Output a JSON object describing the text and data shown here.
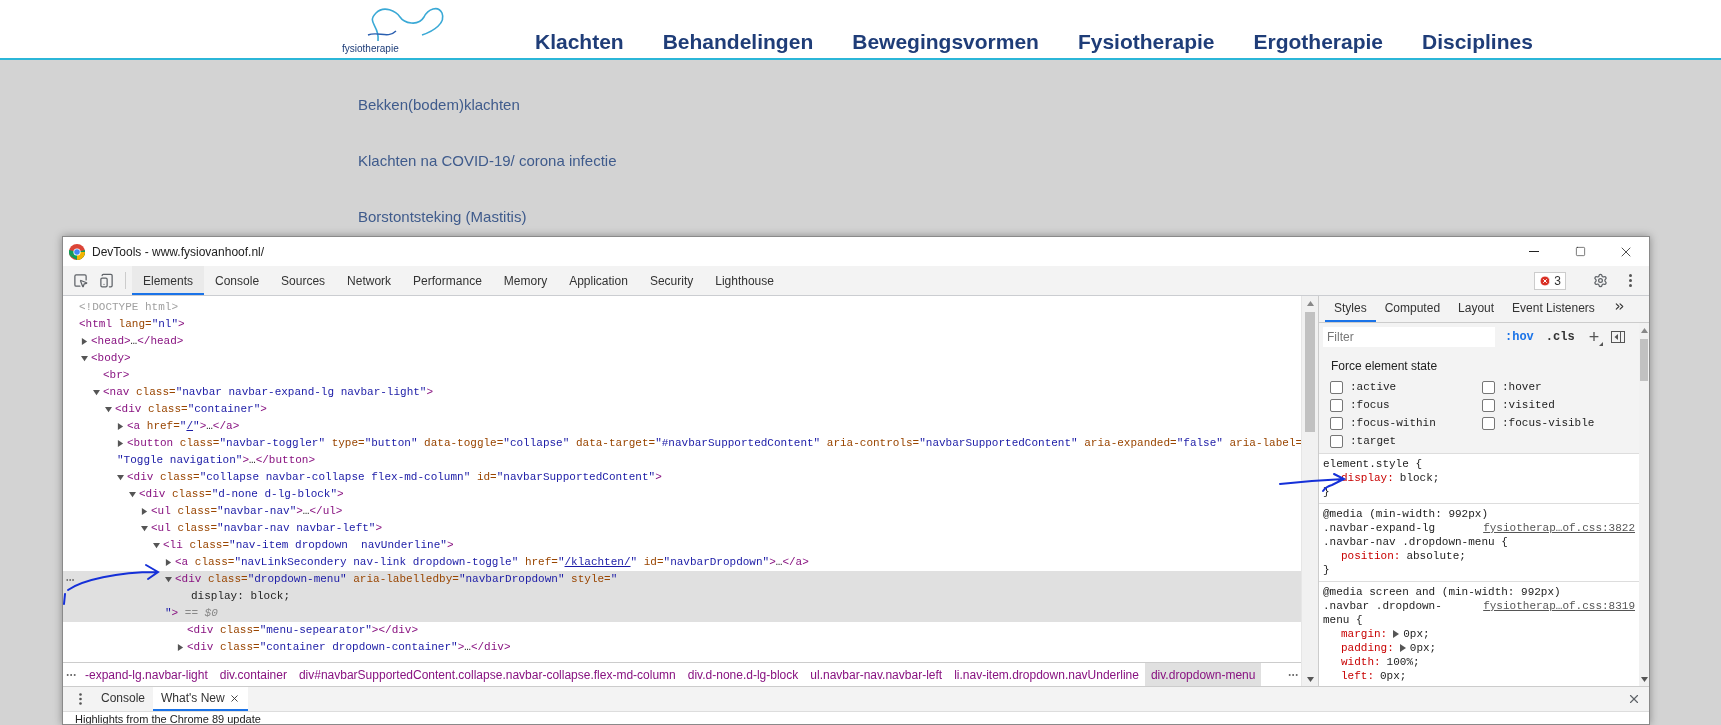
{
  "website": {
    "logo_text": "fysiotherapie",
    "nav": [
      "Klachten",
      "Behandelingen",
      "Bewegingsvormen",
      "Fysiotherapie",
      "Ergotherapie",
      "Disciplines"
    ],
    "dropdown_items": [
      "Bekken(bodem)klachten",
      "Klachten na COVID-19/ corona infectie",
      "Borstontsteking (Mastitis)"
    ]
  },
  "devtools": {
    "title": "DevTools - www.fysiovanhoof.nl/",
    "tabs": [
      {
        "label": "Elements",
        "selected": true
      },
      {
        "label": "Console",
        "selected": false
      },
      {
        "label": "Sources",
        "selected": false
      },
      {
        "label": "Network",
        "selected": false
      },
      {
        "label": "Performance",
        "selected": false
      },
      {
        "label": "Memory",
        "selected": false
      },
      {
        "label": "Application",
        "selected": false
      },
      {
        "label": "Security",
        "selected": false
      },
      {
        "label": "Lighthouse",
        "selected": false
      }
    ],
    "error_count": "3",
    "dom_tree": [
      {
        "selected": false,
        "lines": [
          {
            "kind": "start",
            "tokens": [
              {
                "kind": "comment",
                "text": "<!DOCTYPE html>"
              }
            ]
          }
        ]
      },
      {
        "selected": false,
        "lines": [
          {
            "kind": "start",
            "tokens": [
              {
                "kind": "tag",
                "text": "<html"
              },
              {
                "kind": "attr",
                "text": " lang="
              },
              {
                "kind": "value",
                "text": "\"nl\""
              },
              {
                "kind": "tag",
                "text": ">"
              }
            ]
          }
        ],
        "children": [
          {
            "selected": false,
            "expanded": false,
            "lines": [
              {
                "kind": "start",
                "tokens": [
                  {
                    "kind": "tag",
                    "text": "<head>"
                  },
                  {
                    "kind": "text",
                    "text": "…"
                  },
                  {
                    "kind": "tag",
                    "text": "</head>"
                  }
                ]
              }
            ]
          },
          {
            "selected": false,
            "expanded": true,
            "lines": [
              {
                "kind": "start",
                "tokens": [
                  {
                    "kind": "tag",
                    "text": "<body>"
                  }
                ]
              }
            ],
            "children": [
              {
                "selected": false,
                "lines": [
                  {
                    "kind": "start",
                    "tokens": [
                      {
                        "kind": "tag",
                        "text": "<br>"
                      }
                    ]
                  }
                ]
              },
              {
                "selected": false,
                "expanded": true,
                "lines": [
                  {
                    "kind": "start",
                    "tokens": [
                      {
                        "kind": "tag",
                        "text": "<nav"
                      },
                      {
                        "kind": "attr",
                        "text": " class="
                      },
                      {
                        "kind": "value",
                        "text": "\"navbar navbar-expand-lg navbar-light\""
                      },
                      {
                        "kind": "tag",
                        "text": ">"
                      }
                    ]
                  }
                ],
                "children": [
                  {
                    "selected": false,
                    "expanded": true,
                    "lines": [
                      {
                        "kind": "start",
                        "tokens": [
                          {
                            "kind": "tag",
                            "text": "<div"
                          },
                          {
                            "kind": "attr",
                            "text": " class="
                          },
                          {
                            "kind": "value",
                            "text": "\"container\""
                          },
                          {
                            "kind": "tag",
                            "text": ">"
                          }
                        ]
                      }
                    ],
                    "children": [
                      {
                        "selected": false,
                        "expanded": false,
                        "lines": [
                          {
                            "kind": "start",
                            "tokens": [
                              {
                                "kind": "tag",
                                "text": "<a"
                              },
                              {
                                "kind": "attr",
                                "text": " href="
                              },
                              {
                                "kind": "value",
                                "text": "\""
                              },
                              {
                                "kind": "link",
                                "text": "/"
                              },
                              {
                                "kind": "value",
                                "text": "\""
                              },
                              {
                                "kind": "tag",
                                "text": ">"
                              },
                              {
                                "kind": "text",
                                "text": "…"
                              },
                              {
                                "kind": "tag",
                                "text": "</a>"
                              }
                            ]
                          }
                        ]
                      },
                      {
                        "selected": false,
                        "expanded": false,
                        "lines": [
                          {
                            "kind": "start",
                            "tokens": [
                              {
                                "kind": "tag",
                                "text": "<button"
                              },
                              {
                                "kind": "attr",
                                "text": " class="
                              },
                              {
                                "kind": "value",
                                "text": "\"navbar-toggler\""
                              },
                              {
                                "kind": "attr",
                                "text": " type="
                              },
                              {
                                "kind": "value",
                                "text": "\"button\""
                              },
                              {
                                "kind": "attr",
                                "text": " data-toggle="
                              },
                              {
                                "kind": "value",
                                "text": "\"collapse\""
                              },
                              {
                                "kind": "attr",
                                "text": " data-target="
                              },
                              {
                                "kind": "value",
                                "text": "\"#navbarSupportedContent\""
                              },
                              {
                                "kind": "attr",
                                "text": " aria-controls="
                              },
                              {
                                "kind": "value",
                                "text": "\"navbarSupportedContent\""
                              },
                              {
                                "kind": "attr",
                                "text": " aria-expanded="
                              },
                              {
                                "kind": "value",
                                "text": "\"false\""
                              },
                              {
                                "kind": "attr",
                                "text": " aria-label="
                              }
                            ]
                          },
                          {
                            "kind": "wrap",
                            "tokens": [
                              {
                                "kind": "value",
                                "text": "\"Toggle navigation\""
                              },
                              {
                                "kind": "tag",
                                "text": ">"
                              },
                              {
                                "kind": "text",
                                "text": "…"
                              },
                              {
                                "kind": "tag",
                                "text": "</button>"
                              }
                            ]
                          }
                        ]
                      },
                      {
                        "selected": false,
                        "expanded": true,
                        "lines": [
                          {
                            "kind": "start",
                            "tokens": [
                              {
                                "kind": "tag",
                                "text": "<div"
                              },
                              {
                                "kind": "attr",
                                "text": " class="
                              },
                              {
                                "kind": "value",
                                "text": "\"collapse navbar-collapse flex-md-column\""
                              },
                              {
                                "kind": "attr",
                                "text": " id="
                              },
                              {
                                "kind": "value",
                                "text": "\"navbarSupportedContent\""
                              },
                              {
                                "kind": "tag",
                                "text": ">"
                              }
                            ]
                          }
                        ],
                        "children": [
                          {
                            "selected": false,
                            "expanded": true,
                            "lines": [
                              {
                                "kind": "start",
                                "tokens": [
                                  {
                                    "kind": "tag",
                                    "text": "<div"
                                  },
                                  {
                                    "kind": "attr",
                                    "text": " class="
                                  },
                                  {
                                    "kind": "value",
                                    "text": "\"d-none d-lg-block\""
                                  },
                                  {
                                    "kind": "tag",
                                    "text": ">"
                                  }
                                ]
                              }
                            ],
                            "children": [
                              {
                                "selected": false,
                                "expanded": false,
                                "lines": [
                                  {
                                    "kind": "start",
                                    "tokens": [
                                      {
                                        "kind": "tag",
                                        "text": "<ul"
                                      },
                                      {
                                        "kind": "attr",
                                        "text": " class="
                                      },
                                      {
                                        "kind": "value",
                                        "text": "\"navbar-nav\""
                                      },
                                      {
                                        "kind": "tag",
                                        "text": ">"
                                      },
                                      {
                                        "kind": "text",
                                        "text": "…"
                                      },
                                      {
                                        "kind": "tag",
                                        "text": "</ul>"
                                      }
                                    ]
                                  }
                                ]
                              },
                              {
                                "selected": false,
                                "expanded": true,
                                "lines": [
                                  {
                                    "kind": "start",
                                    "tokens": [
                                      {
                                        "kind": "tag",
                                        "text": "<ul"
                                      },
                                      {
                                        "kind": "attr",
                                        "text": " class="
                                      },
                                      {
                                        "kind": "value",
                                        "text": "\"navbar-nav navbar-left\""
                                      },
                                      {
                                        "kind": "tag",
                                        "text": ">"
                                      }
                                    ]
                                  }
                                ],
                                "children": [
                                  {
                                    "selected": false,
                                    "expanded": true,
                                    "lines": [
                                      {
                                        "kind": "start",
                                        "tokens": [
                                          {
                                            "kind": "tag",
                                            "text": "<li"
                                          },
                                          {
                                            "kind": "attr",
                                            "text": " class="
                                          },
                                          {
                                            "kind": "value",
                                            "text": "\"nav-item dropdown  navUnderline\""
                                          },
                                          {
                                            "kind": "tag",
                                            "text": ">"
                                          }
                                        ]
                                      }
                                    ],
                                    "children": [
                                      {
                                        "selected": false,
                                        "expanded": false,
                                        "lines": [
                                          {
                                            "kind": "start",
                                            "tokens": [
                                              {
                                                "kind": "tag",
                                                "text": "<a"
                                              },
                                              {
                                                "kind": "attr",
                                                "text": " class="
                                              },
                                              {
                                                "kind": "value",
                                                "text": "\"navLinkSecondery nav-link dropdown-toggle\""
                                              },
                                              {
                                                "kind": "attr",
                                                "text": " href="
                                              },
                                              {
                                                "kind": "value",
                                                "text": "\""
                                              },
                                              {
                                                "kind": "link",
                                                "text": "/klachten/"
                                              },
                                              {
                                                "kind": "value",
                                                "text": "\""
                                              },
                                              {
                                                "kind": "attr",
                                                "text": " id="
                                              },
                                              {
                                                "kind": "value",
                                                "text": "\"navbarDropdown\""
                                              },
                                              {
                                                "kind": "tag",
                                                "text": ">"
                                              },
                                              {
                                                "kind": "text",
                                                "text": "…"
                                              },
                                              {
                                                "kind": "tag",
                                                "text": "</a>"
                                              }
                                            ]
                                          }
                                        ]
                                      },
                                      {
                                        "selected": true,
                                        "expanded": true,
                                        "lines": [
                                          {
                                            "kind": "start",
                                            "tokens": [
                                              {
                                                "kind": "tag",
                                                "text": "<div"
                                              },
                                              {
                                                "kind": "attr",
                                                "text": " class="
                                              },
                                              {
                                                "kind": "value",
                                                "text": "\"dropdown-menu\""
                                              },
                                              {
                                                "kind": "attr",
                                                "text": " aria-labelledby="
                                              },
                                              {
                                                "kind": "value",
                                                "text": "\"navbarDropdown\""
                                              },
                                              {
                                                "kind": "attr",
                                                "text": " style="
                                              },
                                              {
                                                "kind": "value",
                                                "text": "\""
                                              }
                                            ]
                                          },
                                          {
                                            "kind": "inner",
                                            "tokens": [
                                              {
                                                "kind": "text",
                                                "text": "display: block;"
                                              }
                                            ]
                                          },
                                          {
                                            "kind": "wrap",
                                            "tokens": [
                                              {
                                                "kind": "value",
                                                "text": "\""
                                              },
                                              {
                                                "kind": "tag",
                                                "text": ">"
                                              },
                                              {
                                                "kind": "marker",
                                                "text": " == $0"
                                              }
                                            ]
                                          }
                                        ],
                                        "children": [
                                          {
                                            "selected": false,
                                            "lines": [
                                              {
                                                "kind": "start",
                                                "tokens": [
                                                  {
                                                    "kind": "tag",
                                                    "text": "<div"
                                                  },
                                                  {
                                                    "kind": "attr",
                                                    "text": " class="
                                                  },
                                                  {
                                                    "kind": "value",
                                                    "text": "\"menu-sepearator\""
                                                  },
                                                  {
                                                    "kind": "tag",
                                                    "text": "></div>"
                                                  }
                                                ]
                                              }
                                            ]
                                          },
                                          {
                                            "selected": false,
                                            "expanded": false,
                                            "lines": [
                                              {
                                                "kind": "start",
                                                "tokens": [
                                                  {
                                                    "kind": "tag",
                                                    "text": "<div"
                                                  },
                                                  {
                                                    "kind": "attr",
                                                    "text": " class="
                                                  },
                                                  {
                                                    "kind": "value",
                                                    "text": "\"container dropdown-container\""
                                                  },
                                                  {
                                                    "kind": "tag",
                                                    "text": ">"
                                                  },
                                                  {
                                                    "kind": "text",
                                                    "text": "…"
                                                  },
                                                  {
                                                    "kind": "tag",
                                                    "text": "</div>"
                                                  }
                                                ]
                                              }
                                            ]
                                          }
                                        ]
                                      }
                                    ]
                                  }
                                ]
                              }
                            ]
                          }
                        ]
                      }
                    ]
                  }
                ]
              }
            ]
          }
        ]
      }
    ],
    "breadcrumbs": [
      {
        "label": "-expand-lg.navbar-light",
        "selected": false
      },
      {
        "label": "div.container",
        "selected": false
      },
      {
        "label": "div#navbarSupportedContent.collapse.navbar-collapse.flex-md-column",
        "selected": false
      },
      {
        "label": "div.d-none.d-lg-block",
        "selected": false
      },
      {
        "label": "ul.navbar-nav.navbar-left",
        "selected": false
      },
      {
        "label": "li.nav-item.dropdown.navUnderline",
        "selected": false
      },
      {
        "label": "div.dropdown-menu",
        "selected": true
      }
    ],
    "styles_tabs": [
      {
        "label": "Styles",
        "selected": true
      },
      {
        "label": "Computed",
        "selected": false
      },
      {
        "label": "Layout",
        "selected": false
      },
      {
        "label": "Event Listeners",
        "selected": false
      }
    ],
    "filter": {
      "placeholder": "Filter"
    },
    "hov": {
      "label": ":hov",
      "on": true
    },
    "cls": ".cls",
    "add": "+",
    "force_title": "Force element state",
    "force_states": [
      {
        "label": ":active",
        "checked": false
      },
      {
        "label": ":hover",
        "checked": false
      },
      {
        "label": ":focus",
        "checked": false
      },
      {
        "label": ":visited",
        "checked": false
      },
      {
        "label": ":focus-within",
        "checked": false
      },
      {
        "label": ":focus-visible",
        "checked": false
      },
      {
        "label": ":target",
        "checked": false
      }
    ],
    "rules": [
      {
        "lines": [
          {
            "text": "element.style {"
          }
        ],
        "declarations": [
          {
            "property": "display:",
            "value": "block;",
            "expandable": false
          }
        ],
        "close": "}"
      },
      {
        "lines": [
          {
            "text": "@media (min-width: 992px)"
          },
          {
            "text": ".navbar-expand-lg",
            "source": "fysiotherap…of.css:3822"
          },
          {
            "text": ".navbar-nav .dropdown-menu {"
          }
        ],
        "declarations": [
          {
            "property": "position:",
            "value": "absolute;",
            "expandable": false
          }
        ],
        "close": "}"
      },
      {
        "lines": [
          {
            "text": "@media screen and (min-width: 992px)"
          },
          {
            "text": ".navbar .dropdown-",
            "source": "fysiotherap…of.css:8319"
          },
          {
            "text": "menu {"
          }
        ],
        "declarations": [
          {
            "property": "margin:",
            "value": "0px;",
            "expandable": true
          },
          {
            "property": "padding:",
            "value": "0px;",
            "expandable": true
          },
          {
            "property": "width:",
            "value": "100%;",
            "expandable": false
          },
          {
            "property": "left:",
            "value": "0px;",
            "expandable": false
          }
        ]
      }
    ],
    "drawer_tabs": [
      {
        "label": "Console",
        "selected": false,
        "closable": false
      },
      {
        "label": "What's New",
        "selected": true,
        "closable": true
      }
    ],
    "drawer_text": "Highlights from the Chrome 89 update"
  }
}
